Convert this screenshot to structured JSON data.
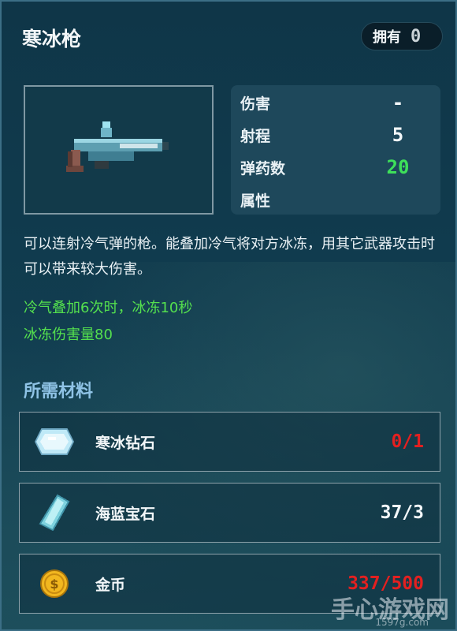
{
  "item": {
    "name": "寒冰枪",
    "owned_label": "拥有",
    "owned_count": "0"
  },
  "stats": [
    {
      "label": "伤害",
      "value": "-",
      "color": "#f3f7f9"
    },
    {
      "label": "射程",
      "value": "5",
      "color": "#f3f7f9"
    },
    {
      "label": "弹药数",
      "value": "20",
      "color": "#3ee05a"
    },
    {
      "label": "属性",
      "value": "",
      "color": "#f3f7f9"
    }
  ],
  "description": "可以连射冷气弹的枪。能叠加冷气将对方冰冻，用其它武器攻击时可以带来较大伤害。",
  "effects": [
    "冷气叠加6次时，冰冻10秒",
    "冰冻伤害量80"
  ],
  "materials_title": "所需材料",
  "materials": [
    {
      "name": "寒冰钻石",
      "count": "0/1",
      "color": "#e32020",
      "icon": "ice-diamond-icon"
    },
    {
      "name": "海蓝宝石",
      "count": "37/3",
      "color": "#f3f7f9",
      "icon": "aquamarine-icon"
    },
    {
      "name": "金币",
      "count": "337/500",
      "color": "#e32020",
      "icon": "gold-coin-icon"
    }
  ],
  "watermark": {
    "text": "手心游戏网",
    "sub": "1597g.com"
  }
}
